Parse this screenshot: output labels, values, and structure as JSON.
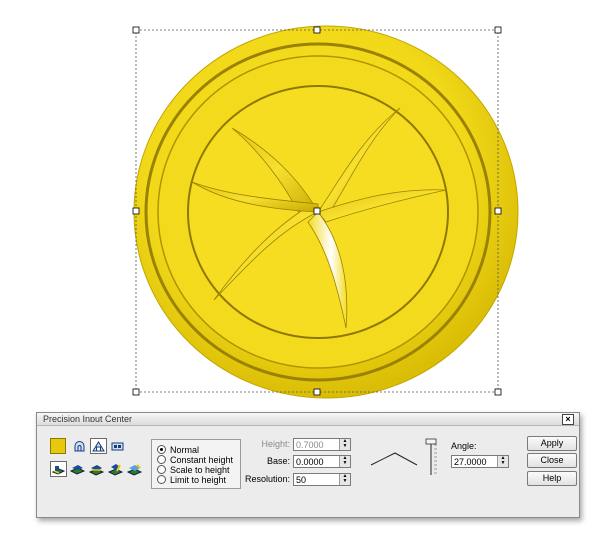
{
  "dialog": {
    "title": "Precision Input Center",
    "close_glyph": "×",
    "swatch_color": "#e8c80c",
    "profile_tools": [
      "profile-round-icon",
      "profile-peak-icon",
      "profile-flat-icon"
    ],
    "shape_tools": [
      "shape-tool-1-icon",
      "shape-tool-2-icon",
      "shape-tool-3-icon",
      "shape-tool-4-icon",
      "shape-tool-5-icon"
    ],
    "height_mode": {
      "options": [
        "Normal",
        "Constant height",
        "Scale to height",
        "Limit to height"
      ],
      "selected": "Normal"
    },
    "fields": {
      "height": {
        "label": "Height:",
        "value": "0.7000"
      },
      "base": {
        "label": "Base:",
        "value": "0.0000"
      },
      "resolution": {
        "label": "Resolution:",
        "value": "50"
      },
      "angle": {
        "label": "Angle:",
        "value": "27.0000"
      }
    },
    "buttons": {
      "apply": "Apply",
      "close": "Close",
      "help": "Help"
    }
  },
  "model": {
    "color": "#f2d91a",
    "shape": "coin-with-swirl-relief"
  }
}
